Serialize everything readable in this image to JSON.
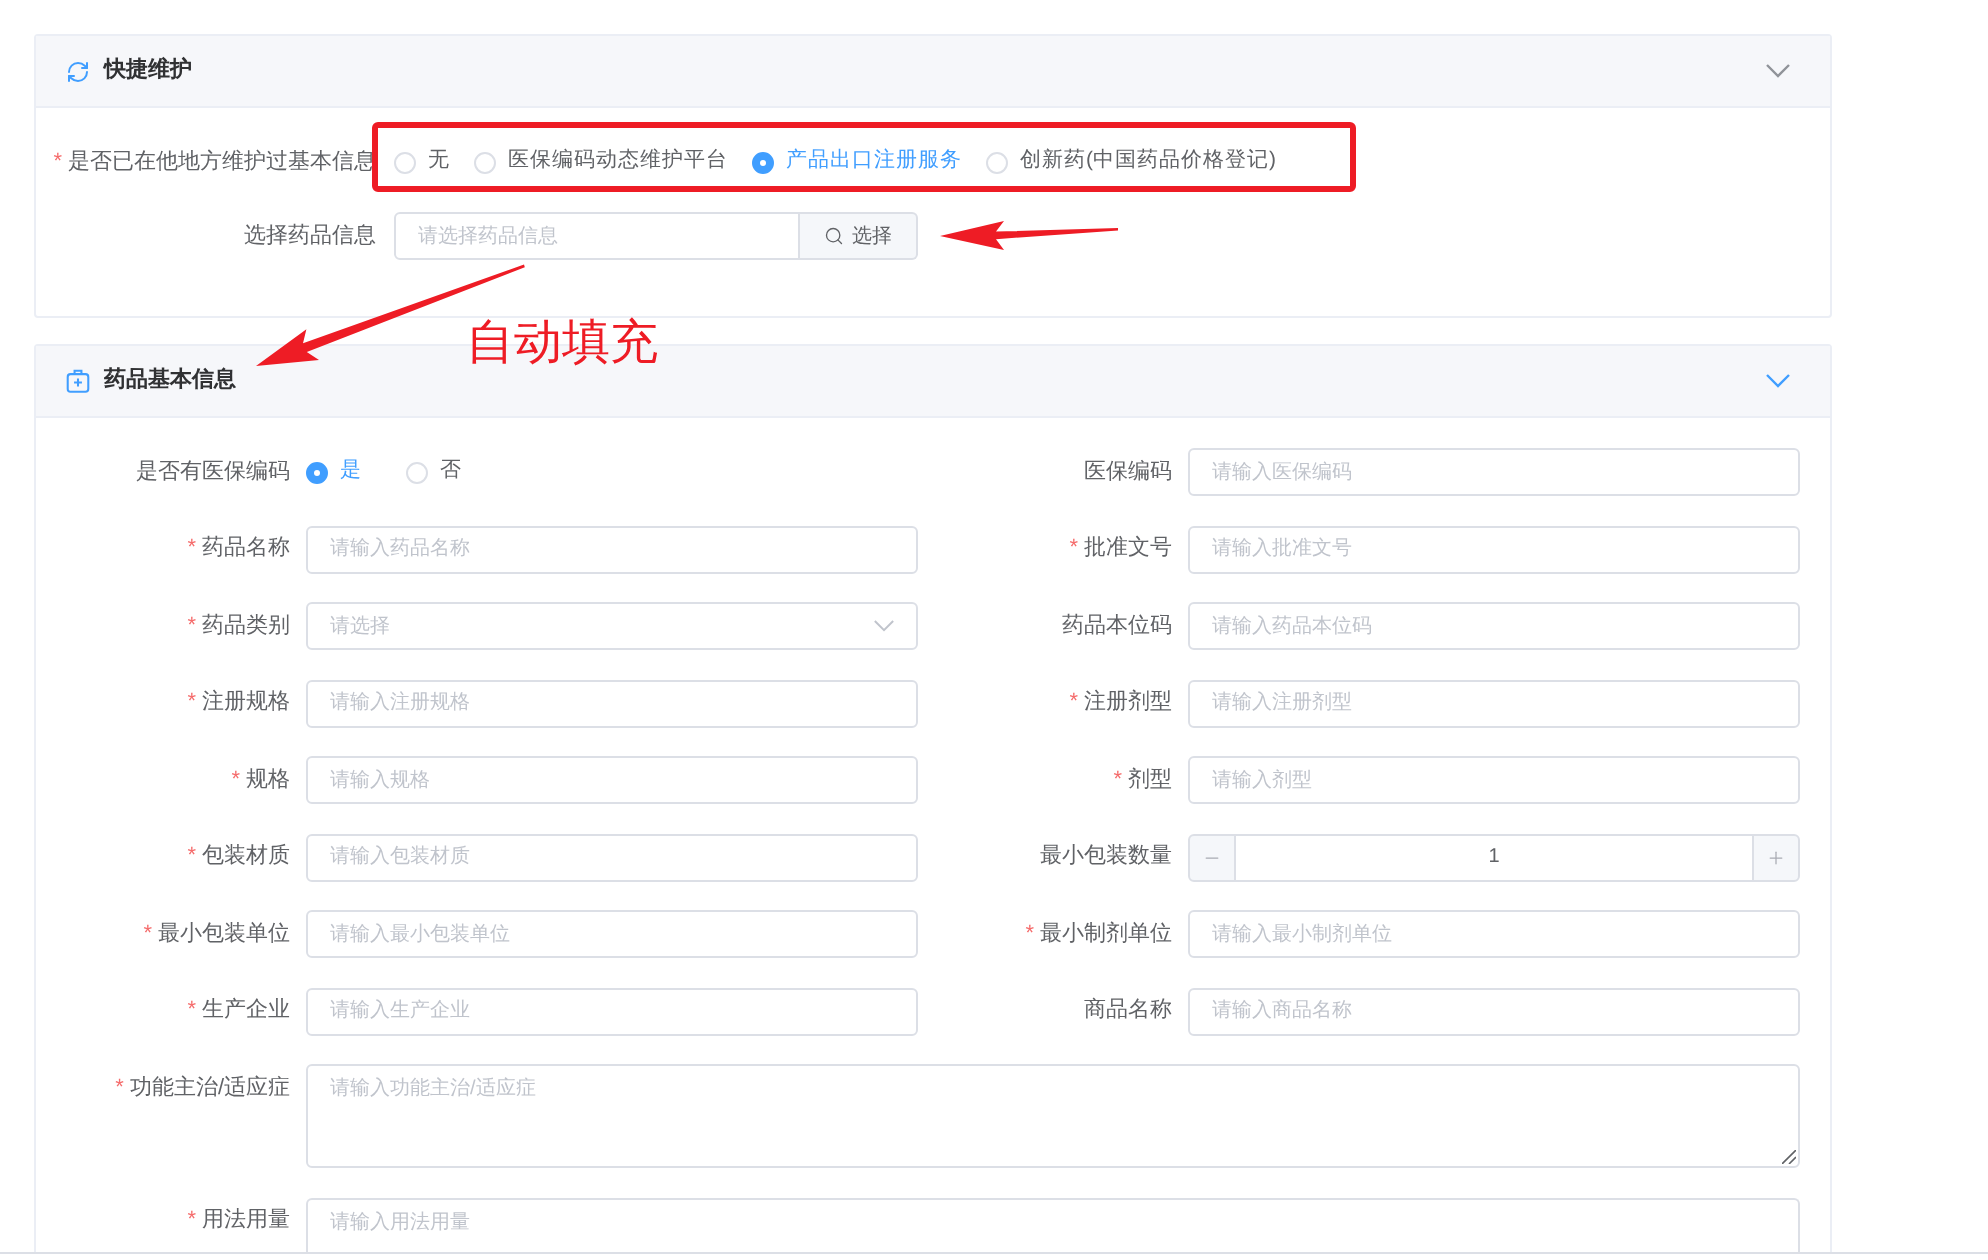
{
  "sections": [
    {
      "kind": "quick",
      "title": "快捷维护",
      "active": false,
      "fields": [
        {
          "kind": "radio",
          "required_mark": "*",
          "label": "是否已在他地方维护过基本信息",
          "options": [
            {
              "label": "无",
              "selected": false
            },
            {
              "label": "医保编码动态维护平台",
              "selected": false
            },
            {
              "label": "产品出口注册服务",
              "selected": true
            },
            {
              "label": "创新药(中国药品价格登记)",
              "selected": false
            }
          ]
        },
        {
          "kind": "search",
          "label": "选择药品信息",
          "placeholder": "请选择药品信息",
          "button": "选择"
        }
      ]
    },
    {
      "kind": "basic",
      "title": "药品基本信息",
      "active": true,
      "fields": [
        {
          "kind": "radio",
          "label": "是否有医保编码",
          "options": [
            {
              "label": "是",
              "selected": true
            },
            {
              "label": "否",
              "selected": false
            }
          ]
        },
        {
          "kind": "input",
          "label": "医保编码",
          "placeholder": "请输入医保编码"
        },
        {
          "kind": "input",
          "required_mark": "*",
          "label": "药品名称",
          "placeholder": "请输入药品名称"
        },
        {
          "kind": "input",
          "required_mark": "*",
          "label": "批准文号",
          "placeholder": "请输入批准文号"
        },
        {
          "kind": "select",
          "required_mark": "*",
          "label": "药品类别",
          "placeholder": "请选择"
        },
        {
          "kind": "input",
          "label": "药品本位码",
          "placeholder": "请输入药品本位码"
        },
        {
          "kind": "input",
          "required_mark": "*",
          "label": "注册规格",
          "placeholder": "请输入注册规格"
        },
        {
          "kind": "input",
          "required_mark": "*",
          "label": "注册剂型",
          "placeholder": "请输入注册剂型"
        },
        {
          "kind": "input",
          "required_mark": "*",
          "label": "规格",
          "placeholder": "请输入规格"
        },
        {
          "kind": "input",
          "required_mark": "*",
          "label": "剂型",
          "placeholder": "请输入剂型"
        },
        {
          "kind": "input",
          "required_mark": "*",
          "label": "包装材质",
          "placeholder": "请输入包装材质"
        },
        {
          "kind": "number",
          "label": "最小包装数量",
          "value": "1"
        },
        {
          "kind": "input",
          "required_mark": "*",
          "label": "最小包装单位",
          "placeholder": "请输入最小包装单位"
        },
        {
          "kind": "input",
          "required_mark": "*",
          "label": "最小制剂单位",
          "placeholder": "请输入最小制剂单位"
        },
        {
          "kind": "input",
          "required_mark": "*",
          "label": "生产企业",
          "placeholder": "请输入生产企业"
        },
        {
          "kind": "input",
          "label": "商品名称",
          "placeholder": "请输入商品名称"
        },
        {
          "kind": "textarea",
          "required_mark": "*",
          "label": "功能主治/适应症",
          "placeholder": "请输入功能主治/适应症"
        },
        {
          "kind": "textarea",
          "required_mark": "*",
          "label": "用法用量",
          "placeholder": "请输入用法用量"
        }
      ]
    }
  ],
  "annotation": {
    "text": "自动填充"
  }
}
